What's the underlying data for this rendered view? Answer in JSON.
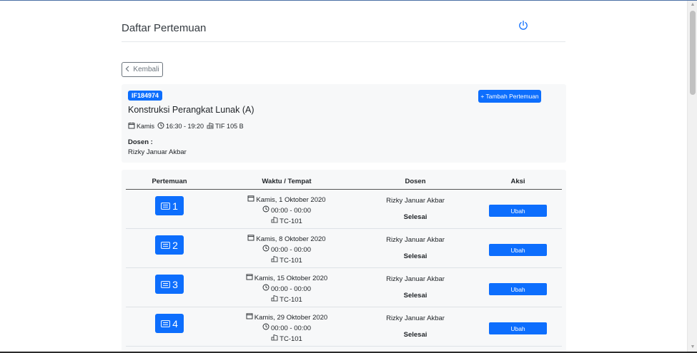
{
  "header": {
    "title": "Daftar Pertemuan",
    "power_icon": "power-icon"
  },
  "back_button": {
    "label": "Kembali",
    "icon": "chevron-left-icon"
  },
  "course": {
    "code": "IF184974",
    "name": "Konstruksi Perangkat Lunak (A)",
    "day": "Kamis",
    "time": "16:30 - 19:20",
    "room": "TIF 105 B",
    "lecturer_label": "Dosen :",
    "lecturer": "Rizky Januar Akbar",
    "add_button": "+ Tambah Pertemuan"
  },
  "table": {
    "headers": [
      "Pertemuan",
      "Waktu / Tempat",
      "Dosen",
      "Aksi"
    ],
    "rows": [
      {
        "number": "1",
        "date": "Kamis, 1 Oktober 2020",
        "time": "00:00 - 00:00",
        "room": "TC-101",
        "lecturer": "Rizky Januar Akbar",
        "status": "Selesai",
        "action": "Ubah"
      },
      {
        "number": "2",
        "date": "Kamis, 8 Oktober 2020",
        "time": "00:00 - 00:00",
        "room": "TC-101",
        "lecturer": "Rizky Januar Akbar",
        "status": "Selesai",
        "action": "Ubah"
      },
      {
        "number": "3",
        "date": "Kamis, 15 Oktober 2020",
        "time": "00:00 - 00:00",
        "room": "TC-101",
        "lecturer": "Rizky Januar Akbar",
        "status": "Selesai",
        "action": "Ubah"
      },
      {
        "number": "4",
        "date": "Kamis, 29 Oktober 2020",
        "time": "00:00 - 00:00",
        "room": "TC-101",
        "lecturer": "Rizky Januar Akbar",
        "status": "Selesai",
        "action": "Ubah"
      }
    ]
  },
  "colors": {
    "primary": "#0d6efd",
    "card_bg": "#f7f8f9",
    "text": "#212529"
  }
}
